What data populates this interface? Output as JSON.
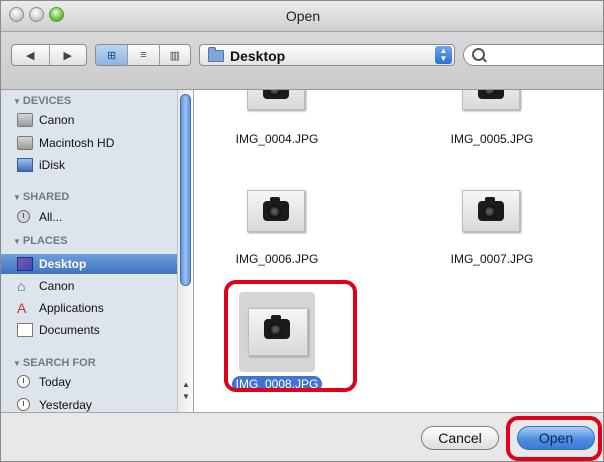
{
  "window": {
    "title": "Open"
  },
  "toolbar": {
    "back_glyph": "◀",
    "forward_glyph": "▶",
    "view_icons": [
      "icon-view-icon",
      "list-view-icon",
      "column-view-icon"
    ],
    "view_glyphs": [
      "⊞",
      "≡",
      "▥"
    ],
    "location": "Desktop",
    "search": {
      "value": "",
      "placeholder": ""
    }
  },
  "sidebar": {
    "devices": {
      "label": "DEVICES",
      "items": [
        {
          "label": "Canon",
          "icon": "hard-drive-icon"
        },
        {
          "label": "Macintosh HD",
          "icon": "hard-drive-icon"
        },
        {
          "label": "iDisk",
          "icon": "idisk-icon"
        }
      ]
    },
    "shared": {
      "label": "SHARED",
      "items": [
        {
          "label": "All...",
          "icon": "network-icon"
        }
      ]
    },
    "places": {
      "label": "PLACES",
      "items": [
        {
          "label": "Desktop",
          "icon": "desktop-icon",
          "selected": true
        },
        {
          "label": "Canon",
          "icon": "home-icon"
        },
        {
          "label": "Applications",
          "icon": "applications-icon"
        },
        {
          "label": "Documents",
          "icon": "documents-icon"
        }
      ]
    },
    "search_for": {
      "label": "SEARCH FOR",
      "items": [
        {
          "label": "Today",
          "icon": "clock-icon"
        },
        {
          "label": "Yesterday",
          "icon": "clock-icon"
        }
      ]
    }
  },
  "files": [
    {
      "name": "IMG_0004.JPG",
      "selected": false
    },
    {
      "name": "IMG_0005.JPG",
      "selected": false
    },
    {
      "name": "IMG_0006.JPG",
      "selected": false
    },
    {
      "name": "IMG_0007.JPG",
      "selected": false
    },
    {
      "name": "IMG_0008.JPG",
      "selected": true
    }
  ],
  "buttons": {
    "cancel": "Cancel",
    "open": "Open"
  },
  "colors": {
    "highlight": "#e1001a",
    "selection": "#3f74d3",
    "sidebar_bg": "#dde4ec"
  }
}
